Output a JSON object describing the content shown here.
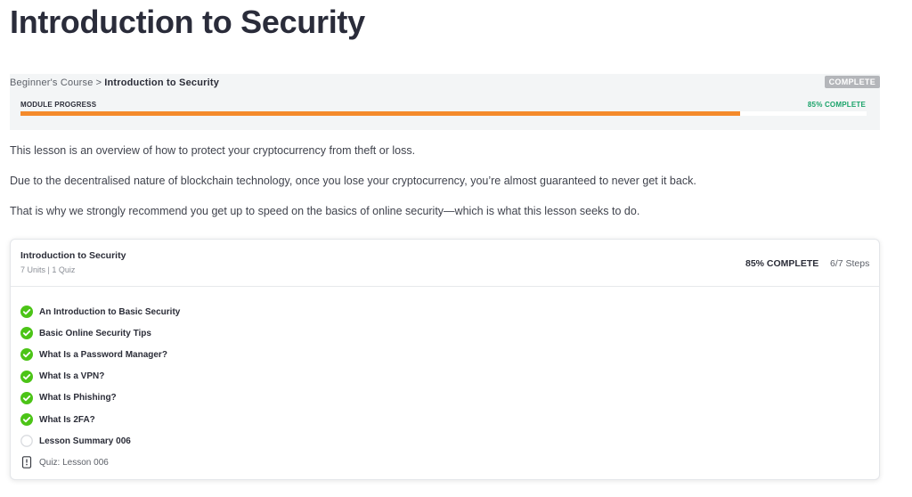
{
  "page": {
    "title": "Introduction to Security"
  },
  "breadcrumb": {
    "parent": "Beginner's Course",
    "separator": ">",
    "current": "Introduction to Security"
  },
  "status_badge": "COMPLETE",
  "module_progress": {
    "label": "MODULE PROGRESS",
    "percent_text": "85% COMPLETE",
    "fraction": 0.85,
    "fill_color": "#f48a2b"
  },
  "intro": {
    "p1": "This lesson is an overview of how to protect your cryptocurrency from theft or loss.",
    "p2": "Due to the decentralised nature of blockchain technology, once you lose your cryptocurrency, you’re almost guaranteed to never get it back.",
    "p3": "That is why we strongly recommend you get up to speed on the basics of online security—which is what this lesson seeks to do."
  },
  "course_card": {
    "title": "Introduction to Security",
    "subtitle": "7 Units | 1 Quiz",
    "complete_text": "85% COMPLETE",
    "steps_text": "6/7 Steps",
    "items": [
      {
        "label": "An Introduction to Basic Security",
        "status": "complete",
        "icon": "check-circle-icon"
      },
      {
        "label": "Basic Online Security Tips",
        "status": "complete",
        "icon": "check-circle-icon"
      },
      {
        "label": "What Is a Password Manager?",
        "status": "complete",
        "icon": "check-circle-icon"
      },
      {
        "label": "What Is a VPN?",
        "status": "complete",
        "icon": "check-circle-icon"
      },
      {
        "label": "What Is Phishing?",
        "status": "complete",
        "icon": "check-circle-icon"
      },
      {
        "label": "What Is 2FA?",
        "status": "complete",
        "icon": "check-circle-icon"
      },
      {
        "label": "Lesson Summary 006",
        "status": "incomplete",
        "icon": "empty-circle-icon"
      },
      {
        "label": "Quiz: Lesson 006",
        "status": "quiz",
        "icon": "quiz-icon"
      }
    ]
  },
  "colors": {
    "complete_green": "#4cc417",
    "accent_orange": "#f48a2b",
    "percent_green": "#1aa36a"
  }
}
